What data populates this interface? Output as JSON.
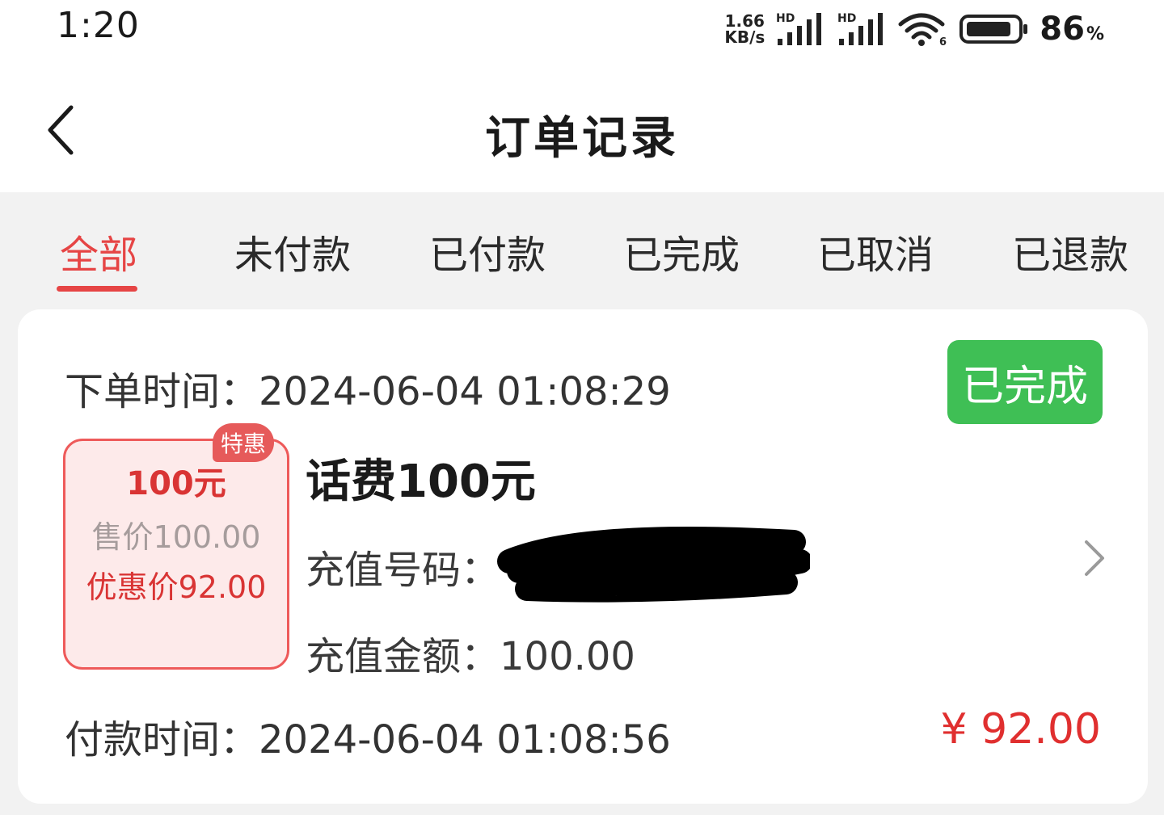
{
  "status_bar": {
    "time": "1:20",
    "net_speed_value": "1.66",
    "net_speed_unit": "KB/s",
    "signal_1_tag": "HD",
    "signal_2_tag": "HD",
    "wifi_tag": "6",
    "battery_percent": "86",
    "battery_symbol": "%"
  },
  "header": {
    "title": "订单记录"
  },
  "tabs": [
    {
      "label": "全部",
      "active": true
    },
    {
      "label": "未付款",
      "active": false
    },
    {
      "label": "已付款",
      "active": false
    },
    {
      "label": "已完成",
      "active": false
    },
    {
      "label": "已取消",
      "active": false
    },
    {
      "label": "已退款",
      "active": false
    }
  ],
  "order": {
    "order_time_label": "下单时间：",
    "order_time": "2024-06-04 01:08:29",
    "status": "已完成",
    "thumb": {
      "badge": "特惠",
      "amount": "100元",
      "price": "售价100.00",
      "discount_price": "优惠价92.00"
    },
    "product_title": "话费100元",
    "recharge_number_label": "充值号码：",
    "recharge_amount_label": "充值金额：",
    "recharge_amount": "100.00",
    "pay_time_label": "付款时间：",
    "pay_time": "2024-06-04 01:08:56",
    "pay_amount": "¥ 92.00"
  },
  "colors": {
    "accent_red": "#e64545",
    "status_green": "#3fbf55",
    "price_red": "#e02f2f",
    "page_bg": "#f2f2f2"
  }
}
